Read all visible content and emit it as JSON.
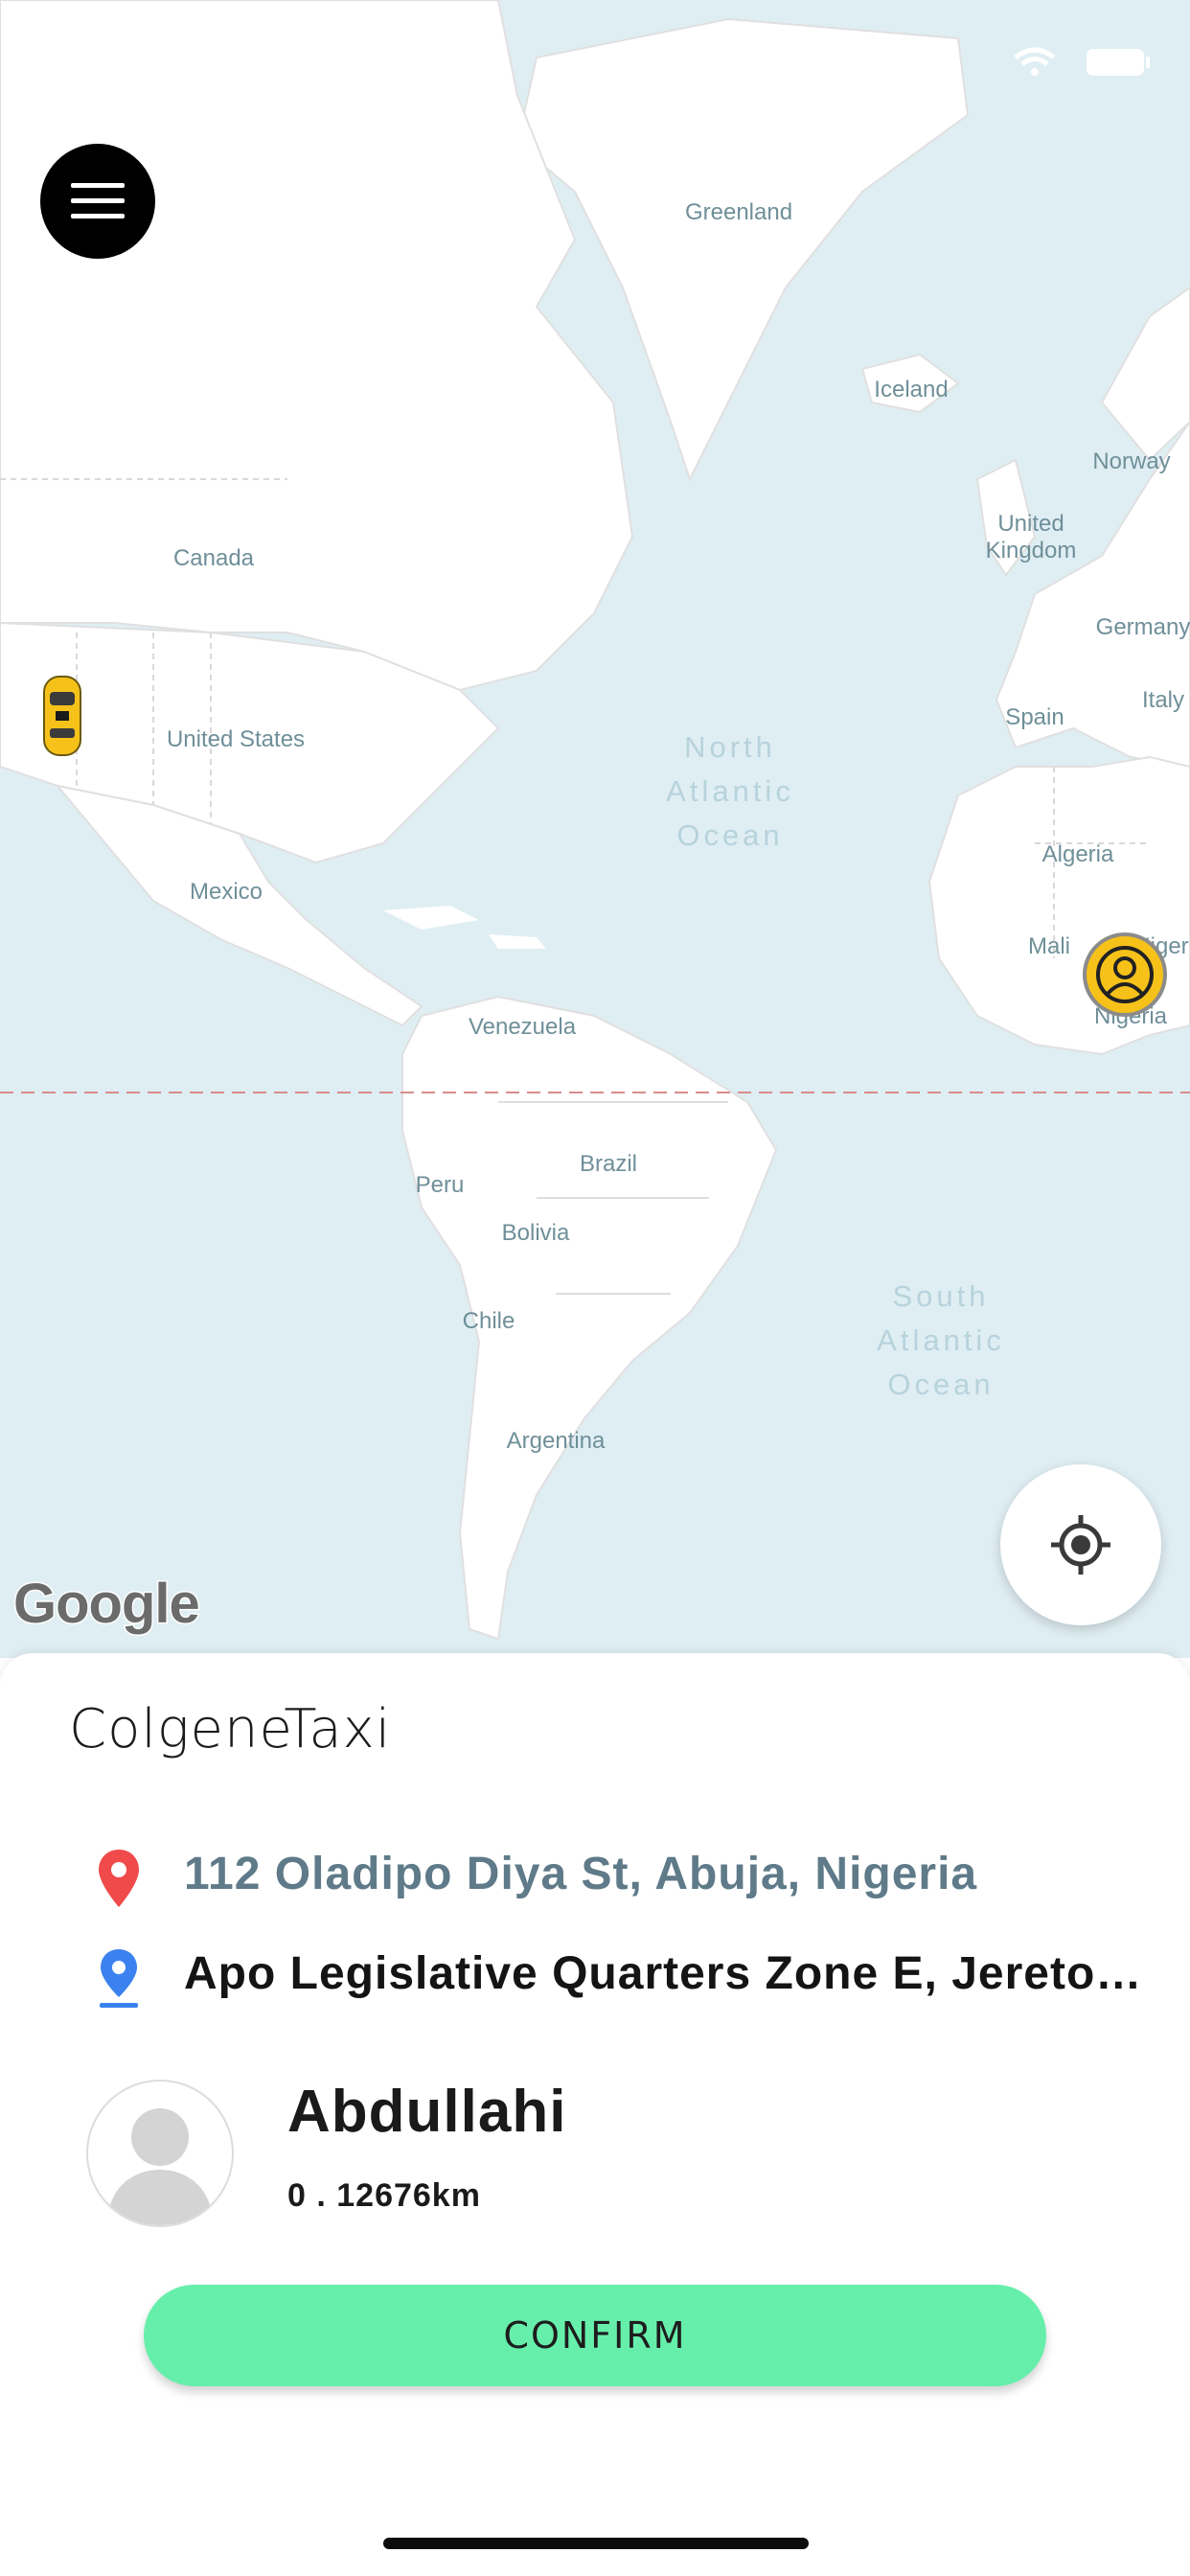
{
  "app": {
    "title": "ColgeneTaxi"
  },
  "map": {
    "attribution": "Google",
    "countries": [
      "Greenland",
      "Iceland",
      "Norway",
      "United Kingdom",
      "Germany",
      "Italy",
      "Spain",
      "Canada",
      "United States",
      "Mexico",
      "Algeria",
      "Mali",
      "Niger",
      "Nigeria",
      "Venezuela",
      "Brazil",
      "Peru",
      "Bolivia",
      "Chile",
      "Argentina"
    ],
    "oceans": [
      "North Atlantic Ocean",
      "South Atlantic Ocean"
    ]
  },
  "trip": {
    "pickup": "112 Oladipo Diya St, Abuja, Nigeria",
    "destination": "Apo Legislative Quarters Zone E, Jereton ..."
  },
  "driver": {
    "name": "Abdullahi",
    "distance": "0 . 12676km"
  },
  "actions": {
    "confirm_label": "CONFIRM"
  },
  "colors": {
    "pickup_pin": "#f04a4a",
    "destination_pin": "#3b82f0",
    "confirm_button": "#66efab",
    "taxi": "#f6c21a"
  },
  "icons": {
    "menu": "hamburger-icon",
    "locate": "crosshair-icon",
    "taxi": "taxi-car-icon",
    "user": "user-location-icon",
    "pickup": "red-pin-icon",
    "destination": "blue-pin-icon",
    "avatar": "person-silhouette-icon"
  }
}
